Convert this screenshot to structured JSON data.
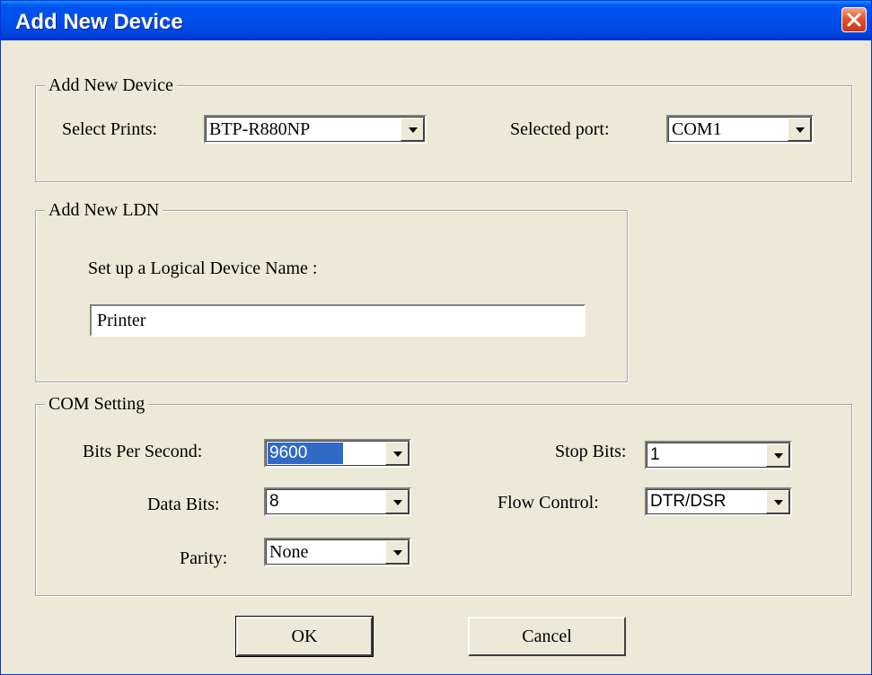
{
  "window": {
    "title": "Add New Device"
  },
  "device_group": {
    "legend": "Add New Device",
    "select_prints_label": "Select Prints:",
    "select_prints_value": "BTP-R880NP",
    "selected_port_label": "Selected port:",
    "selected_port_value": "COM1"
  },
  "ldn_group": {
    "legend": "Add New LDN",
    "prompt": "Set up a Logical Device Name :",
    "name_value": "Printer"
  },
  "com_group": {
    "legend": "COM Setting",
    "bits_per_second_label": "Bits Per Second:",
    "bits_per_second_value": "9600",
    "data_bits_label": "Data Bits:",
    "data_bits_value": "8",
    "parity_label": "Parity:",
    "parity_value": "None",
    "stop_bits_label": "Stop Bits:",
    "stop_bits_value": "1",
    "flow_control_label": "Flow Control:",
    "flow_control_value": "DTR/DSR"
  },
  "buttons": {
    "ok": "OK",
    "cancel": "Cancel"
  },
  "colors": {
    "titlebar": "#0053ee",
    "dialog_bg": "#ece9d8",
    "selection": "#316ac5",
    "close": "#e5532c"
  }
}
